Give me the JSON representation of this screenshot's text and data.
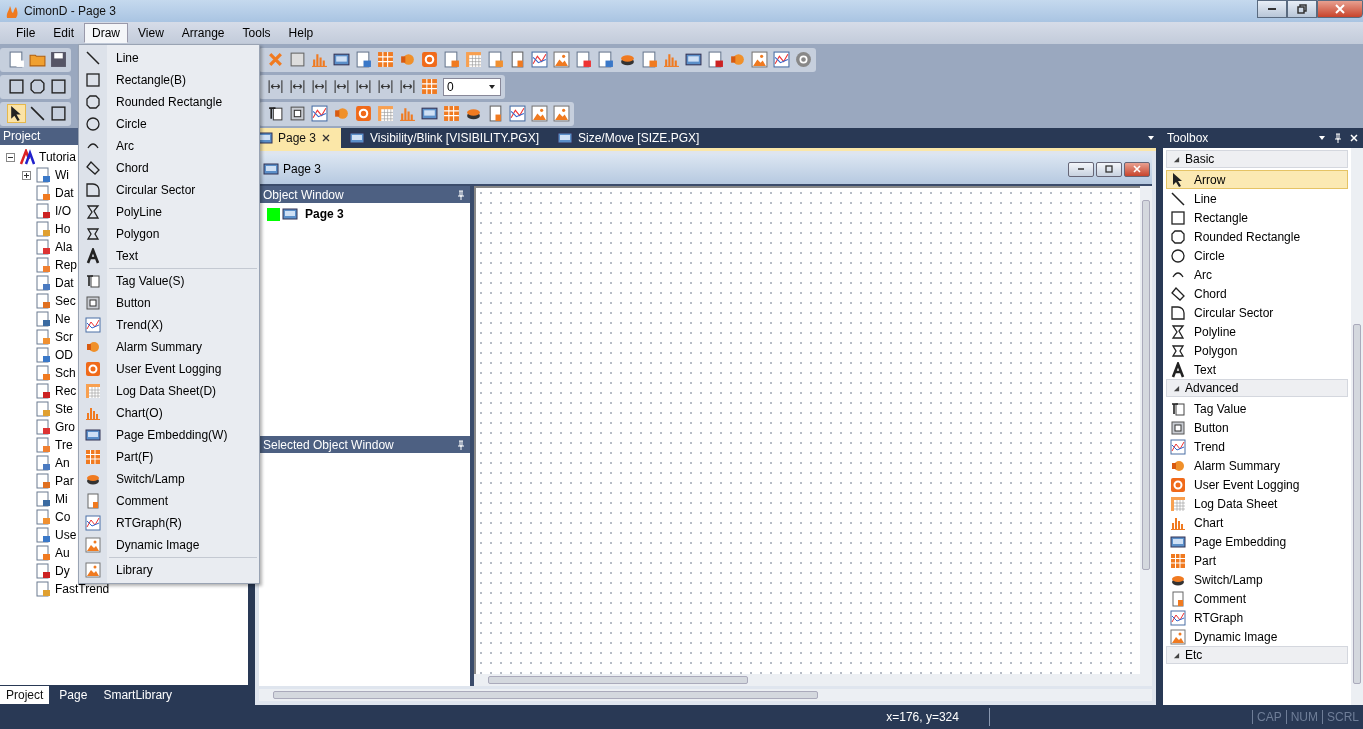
{
  "window": {
    "title": "CimonD - Page 3"
  },
  "menu_bar": [
    {
      "label": "File",
      "selected": false
    },
    {
      "label": "Edit",
      "selected": false
    },
    {
      "label": "Draw",
      "selected": true
    },
    {
      "label": "View",
      "selected": false
    },
    {
      "label": "Arrange",
      "selected": false
    },
    {
      "label": "Tools",
      "selected": false
    },
    {
      "label": "Help",
      "selected": false
    }
  ],
  "toolbar": {
    "combo_value": "0"
  },
  "draw_menu": {
    "groups": [
      {
        "items": [
          "Line",
          "Rectangle(B)",
          "Rounded Rectangle",
          "Circle",
          "Arc",
          "Chord",
          "Circular Sector",
          "PolyLine",
          "Polygon",
          "Text"
        ]
      },
      {
        "items": [
          "Tag Value(S)",
          "Button",
          "Trend(X)",
          "Alarm Summary",
          "User Event Logging",
          "Log Data Sheet(D)",
          "Chart(O)",
          "Page Embedding(W)",
          "Part(F)",
          "Switch/Lamp",
          "Comment",
          "RTGraph(R)",
          "Dynamic Image"
        ]
      },
      {
        "items": [
          "Library"
        ]
      }
    ]
  },
  "project": {
    "title": "Project",
    "tree": {
      "label": "Tutoria",
      "expanded": true,
      "children": [
        {
          "label": "Wi",
          "expanded": false
        },
        {
          "label": "Dat"
        },
        {
          "label": "I/O"
        },
        {
          "label": "Ho"
        },
        {
          "label": "Ala"
        },
        {
          "label": "Rep"
        },
        {
          "label": "Dat"
        },
        {
          "label": "Sec"
        },
        {
          "label": "Ne"
        },
        {
          "label": "Scr"
        },
        {
          "label": "OD"
        },
        {
          "label": "Sch"
        },
        {
          "label": "Rec"
        },
        {
          "label": "Ste"
        },
        {
          "label": "Gro"
        },
        {
          "label": "Tre"
        },
        {
          "label": "An"
        },
        {
          "label": "Par"
        },
        {
          "label": "Mi"
        },
        {
          "label": "Co"
        },
        {
          "label": "Use"
        },
        {
          "label": "Au"
        },
        {
          "label": "Dy"
        },
        {
          "label": "FastTrend"
        }
      ]
    },
    "tabs": [
      {
        "label": "Project",
        "selected": true
      },
      {
        "label": "Page",
        "selected": false
      },
      {
        "label": "SmartLibrary",
        "selected": false
      }
    ]
  },
  "document_tabs": [
    {
      "label": "Page 3",
      "selected": true
    },
    {
      "label": "Visibility/Blink [VISIBILITY.PGX]",
      "selected": false
    },
    {
      "label": "Size/Move [SIZE.PGX]",
      "selected": false
    }
  ],
  "page_window": {
    "title": "Page 3",
    "object_window": {
      "title": "Object Window",
      "items": [
        {
          "label": "Page 3"
        }
      ]
    },
    "selected_object_window": {
      "title": "Selected Object Window"
    }
  },
  "toolbox": {
    "title": "Toolbox",
    "groups": [
      {
        "label": "Basic",
        "items": [
          {
            "label": "Arrow",
            "selected": true
          },
          {
            "label": "Line",
            "selected": false
          },
          {
            "label": "Rectangle",
            "selected": false
          },
          {
            "label": "Rounded Rectangle",
            "selected": false
          },
          {
            "label": "Circle",
            "selected": false
          },
          {
            "label": "Arc",
            "selected": false
          },
          {
            "label": "Chord",
            "selected": false
          },
          {
            "label": "Circular Sector",
            "selected": false
          },
          {
            "label": "Polyline",
            "selected": false
          },
          {
            "label": "Polygon",
            "selected": false
          },
          {
            "label": "Text",
            "selected": false
          }
        ]
      },
      {
        "label": "Advanced",
        "items": [
          {
            "label": "Tag Value",
            "selected": false
          },
          {
            "label": "Button",
            "selected": false
          },
          {
            "label": "Trend",
            "selected": false
          },
          {
            "label": "Alarm Summary",
            "selected": false
          },
          {
            "label": "User Event Logging",
            "selected": false
          },
          {
            "label": "Log Data Sheet",
            "selected": false
          },
          {
            "label": "Chart",
            "selected": false
          },
          {
            "label": "Page Embedding",
            "selected": false
          },
          {
            "label": "Part",
            "selected": false
          },
          {
            "label": "Switch/Lamp",
            "selected": false
          },
          {
            "label": "Comment",
            "selected": false
          },
          {
            "label": "RTGraph",
            "selected": false
          },
          {
            "label": "Dynamic Image",
            "selected": false
          }
        ]
      },
      {
        "label": "Etc"
      }
    ]
  },
  "status_bar": {
    "coordinates": "x=176, y=324",
    "indicators": [
      {
        "label": "CAP",
        "on": false
      },
      {
        "label": "NUM",
        "on": false
      },
      {
        "label": "SCRL",
        "on": false
      }
    ]
  }
}
